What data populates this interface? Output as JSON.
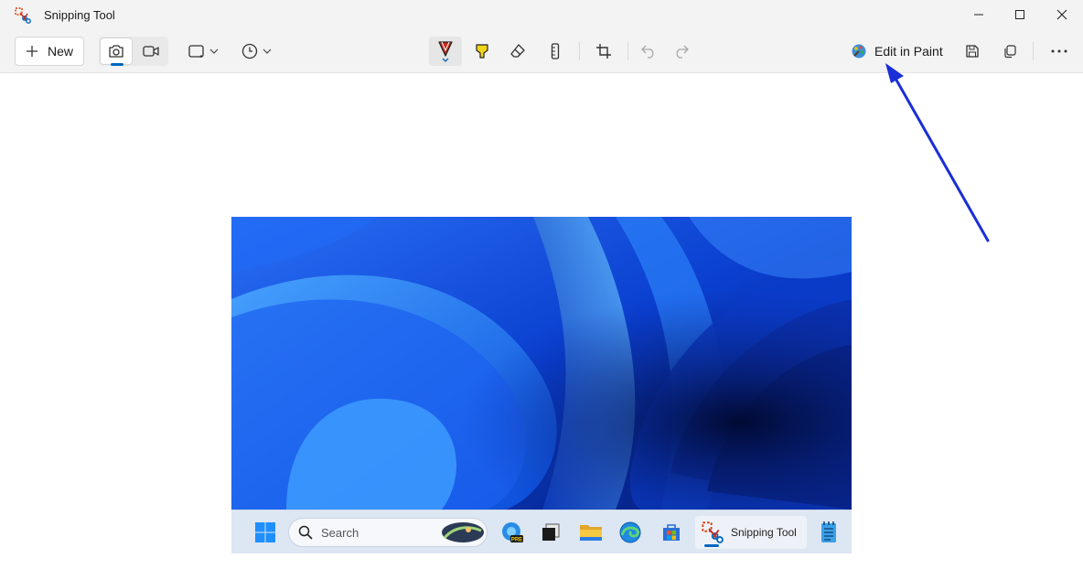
{
  "window": {
    "title": "Snipping Tool"
  },
  "toolbar": {
    "new_label": "New",
    "edit_in_paint_label": "Edit in Paint"
  },
  "screenshot": {
    "taskbar": {
      "search_placeholder": "Search",
      "snipping_tool_label": "Snipping Tool",
      "edge_badge": "PRE"
    }
  },
  "colors": {
    "accent": "#0067c0",
    "annotation_arrow": "#1a2fd6",
    "pen_red": "#c42b1c",
    "highlighter_yellow": "#f2d51a"
  },
  "icons": [
    "snipping-tool-app-icon",
    "minimize-icon",
    "maximize-icon",
    "close-icon",
    "plus-icon",
    "camera-icon",
    "video-icon",
    "rectangle-snip-icon",
    "chevron-down-icon",
    "timer-icon",
    "ballpoint-pen-icon",
    "highlighter-icon",
    "eraser-icon",
    "ruler-icon",
    "crop-icon",
    "undo-icon",
    "redo-icon",
    "paint-icon",
    "save-icon",
    "copy-icon",
    "more-icon"
  ]
}
